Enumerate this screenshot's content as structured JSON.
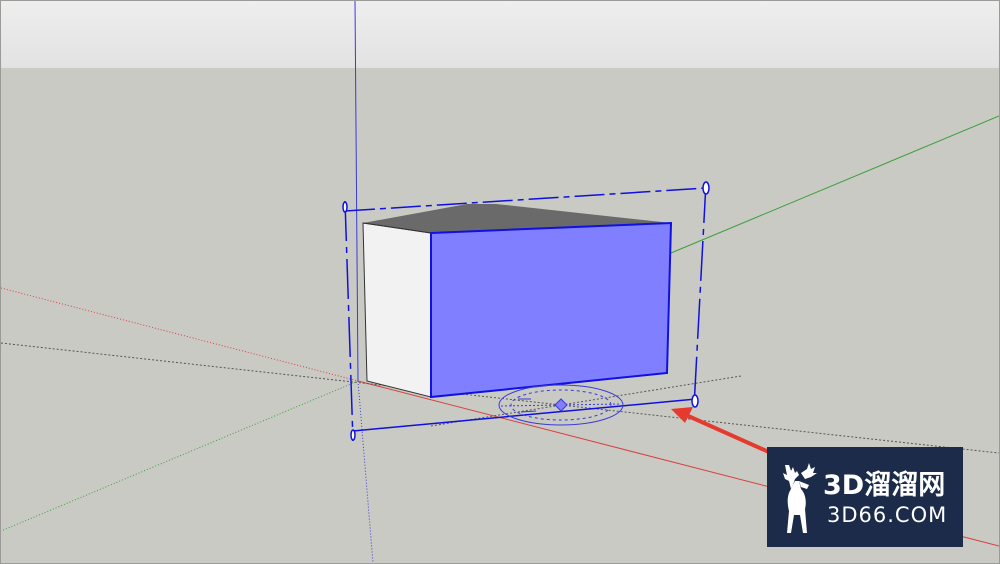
{
  "viewport": {
    "sky_color": "#e8e8e8",
    "ground_color": "#cacac5"
  },
  "axes": {
    "red": "#d94040",
    "green": "#3aa03a",
    "blue": "#3a3ad9"
  },
  "model": {
    "selected_face_color": "#7f7fff",
    "selection_color": "#1010e0",
    "side_face_color": "#f2f2f2",
    "top_face_color": "#6a6a6a"
  },
  "tool": {
    "name": "rotate-protractor"
  },
  "annotation": {
    "arrow_color": "#e53a2e"
  },
  "watermark": {
    "title": "3D溜溜网",
    "url": "3D66.COM",
    "bg_color": "#1c2b4a"
  }
}
